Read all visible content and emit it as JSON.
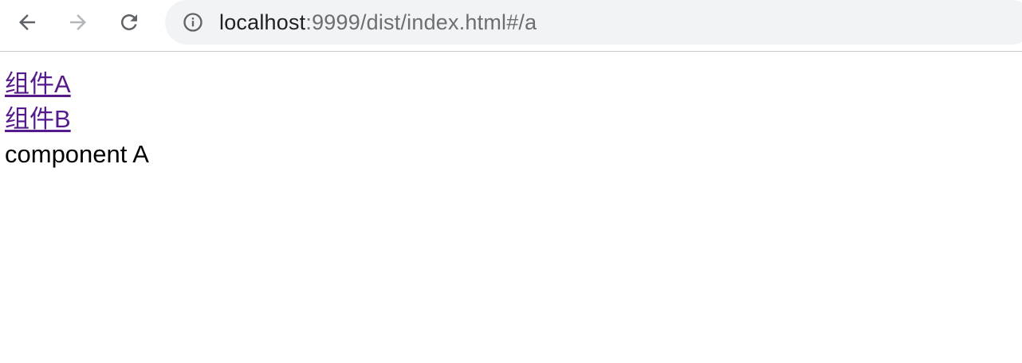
{
  "browser": {
    "url_host": "localhost",
    "url_rest": ":9999/dist/index.html#/a",
    "icons": {
      "back": "arrow-left-icon",
      "forward": "arrow-right-icon",
      "reload": "reload-icon",
      "info": "info-icon"
    },
    "colors": {
      "omnibox_bg": "#f1f3f4",
      "url_host": "#202124",
      "url_rest": "#6b6f73",
      "visited_link": "#551a8b"
    }
  },
  "page": {
    "links": [
      "组件A",
      "组件B"
    ],
    "component_text": "component A"
  }
}
